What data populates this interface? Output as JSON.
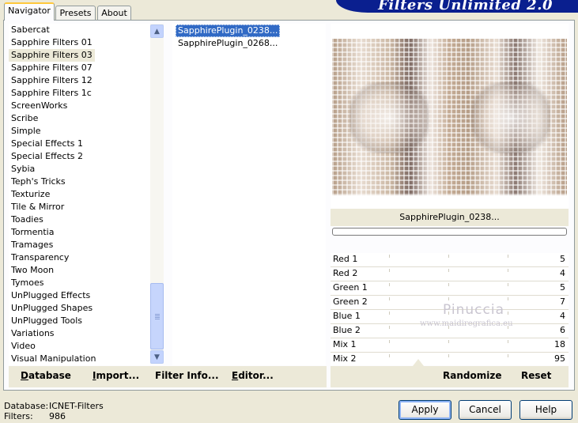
{
  "app": {
    "title": "Filters Unlimited 2.0"
  },
  "tabs": [
    {
      "label": "Navigator",
      "active": true
    },
    {
      "label": "Presets",
      "active": false
    },
    {
      "label": "About",
      "active": false
    }
  ],
  "categories": {
    "selected": "Sapphire Filters 03",
    "items": [
      "Sabercat",
      "Sapphire Filters 01",
      "Sapphire Filters 03",
      "Sapphire Filters 07",
      "Sapphire Filters 12",
      "Sapphire Filters 1c",
      "ScreenWorks",
      "Scribe",
      "Simple",
      "Special Effects 1",
      "Special Effects 2",
      "Sybia",
      "Teph's Tricks",
      "Texturize",
      "Tile & Mirror",
      "Toadies",
      "Tormentia",
      "Tramages",
      "Transparency",
      "Two Moon",
      "Tymoes",
      "UnPlugged Effects",
      "UnPlugged Shapes",
      "UnPlugged Tools",
      "Variations",
      "Video",
      "Visual Manipulation"
    ]
  },
  "filters": {
    "selected": "SapphirePlugin_0238...",
    "items": [
      "SapphirePlugin_0238...",
      "SapphirePlugin_0268..."
    ]
  },
  "left_actions": {
    "database": "Database",
    "import": "Import...",
    "filter_info": "Filter Info...",
    "editor": "Editor..."
  },
  "preview": {
    "caption": "SapphirePlugin_0238..."
  },
  "parameters": [
    {
      "name": "Red 1",
      "value": "5"
    },
    {
      "name": "Red 2",
      "value": "4"
    },
    {
      "name": "Green 1",
      "value": "5"
    },
    {
      "name": "Green 2",
      "value": "7"
    },
    {
      "name": "Blue 1",
      "value": "4"
    },
    {
      "name": "Blue 2",
      "value": "6"
    },
    {
      "name": "Mix 1",
      "value": "18"
    },
    {
      "name": "Mix 2",
      "value": "95"
    }
  ],
  "right_actions": {
    "randomize": "Randomize",
    "reset": "Reset"
  },
  "watermark": {
    "name": "Pinuccia",
    "url": "www.maidiregrafica.eu"
  },
  "status": {
    "database_label": "Database:",
    "database_value": "ICNET-Filters",
    "filters_label": "Filters:",
    "filters_value": "986"
  },
  "buttons": {
    "apply": "Apply",
    "cancel": "Cancel",
    "help": "Help"
  },
  "icons": {
    "scroll_up": "chevron-up-icon",
    "scroll_down": "chevron-down-icon"
  },
  "colors": {
    "banner": "#0a1f8f",
    "selection": "#316ac5",
    "face": "#ece9d8"
  }
}
